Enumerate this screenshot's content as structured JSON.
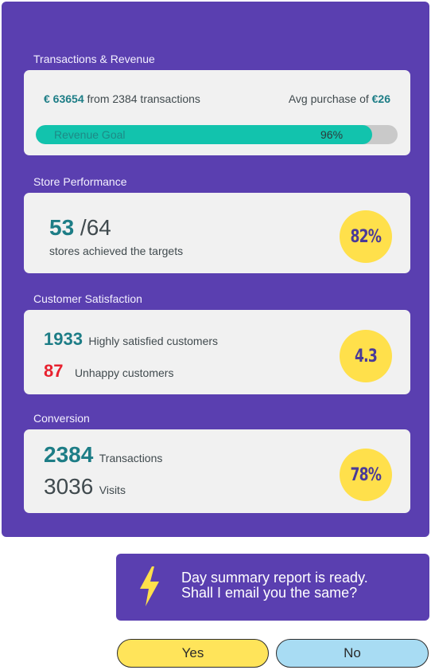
{
  "sections": {
    "transactions": {
      "title": "Transactions & Revenue",
      "revenue": "€ 63654",
      "revenue_suffix": " from 2384 transactions",
      "avg_prefix": "Avg purchase of ",
      "avg_value": "€26",
      "goal_label": "Revenue Goal",
      "goal_pct_text": "96%",
      "goal_fraction": 0.93
    },
    "store": {
      "title": "Store Performance",
      "achieved": "53",
      "total": " /64",
      "caption": "stores achieved the targets",
      "badge": "82%"
    },
    "satisfaction": {
      "title": "Customer Satisfaction",
      "happy_count": "1933",
      "happy_label": "Highly satisfied customers",
      "unhappy_count": "87",
      "unhappy_label": "Unhappy customers",
      "badge": "4.3"
    },
    "conversion": {
      "title": "Conversion",
      "transactions_count": "2384",
      "transactions_label": "Transactions",
      "visits_count": "3036",
      "visits_label": "Visits",
      "badge": "78%"
    }
  },
  "bot_message": {
    "line1": "Day summary report is ready.",
    "line2": "Shall I email you the same?",
    "icon": "lightning-bolt-icon"
  },
  "actions": {
    "yes_label": "Yes",
    "no_label": "No"
  },
  "colors": {
    "panel": "#5a3fb0",
    "badge": "#ffe04b",
    "accent_teal": "#1d7d86",
    "progress": "#12c3ad",
    "negative": "#e8212f",
    "yes_button": "#ffe45a",
    "no_button": "#a8dcf3"
  }
}
